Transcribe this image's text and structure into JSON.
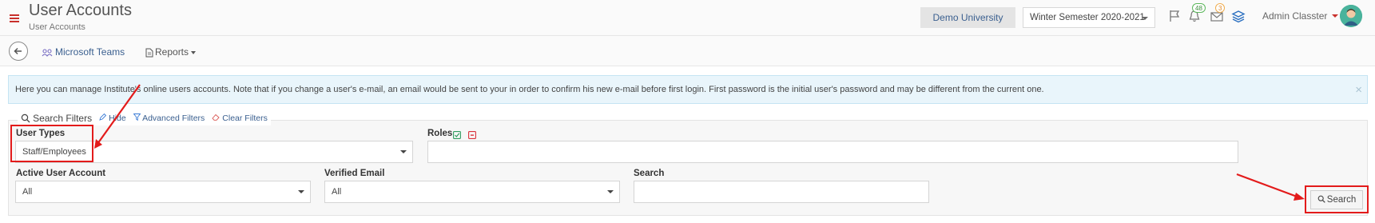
{
  "header": {
    "title": "User Accounts",
    "subtitle": "User Accounts",
    "university": "Demo University",
    "semester": "Winter Semester 2020-2021",
    "notifications_count": "48",
    "messages_count": "3",
    "user_name": "Admin Classter"
  },
  "toolbar": {
    "microsoft_teams": "Microsoft Teams",
    "reports": "Reports"
  },
  "info": {
    "text": "Here you can manage Institute's online users accounts. Note that if you change a user's e-mail, an email would be sent to your in order to confirm his new e-mail before first login. First password is the initial user's password and may be different from the current one."
  },
  "filters": {
    "title": "Search Filters",
    "hide": "Hide",
    "advanced": "Advanced Filters",
    "clear": "Clear Filters",
    "user_types": {
      "label": "User Types",
      "value": "Staff/Employees"
    },
    "roles": {
      "label": "Roles",
      "value": ""
    },
    "active_user_account": {
      "label": "Active User Account",
      "value": "All"
    },
    "verified_email": {
      "label": "Verified Email",
      "value": "All"
    },
    "search": {
      "label": "Search",
      "value": ""
    },
    "search_button": "Search"
  },
  "colors": {
    "accent": "#3a5f8f",
    "highlight": "#e31b1b",
    "info_bg": "#e9f5fb"
  }
}
